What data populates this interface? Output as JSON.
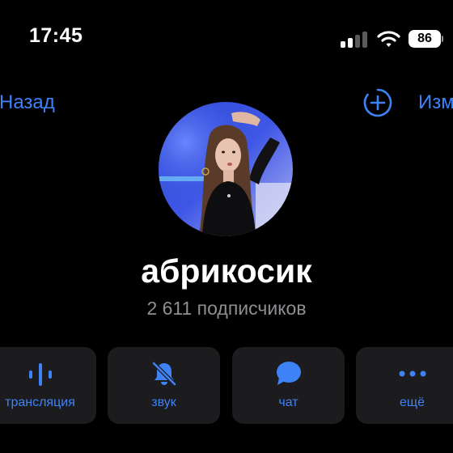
{
  "status_bar": {
    "time": "17:45",
    "battery": "86",
    "icons": [
      "cellular-signal-icon",
      "wifi-icon",
      "battery-icon"
    ]
  },
  "nav": {
    "back_label": "Назад",
    "add_icon": "add-circle-icon",
    "edit_label": "Изм"
  },
  "profile": {
    "name": "абрикосик",
    "subscribers": "2 611 подписчиков"
  },
  "actions": [
    {
      "label": "трансляция",
      "icon": "live-stream-icon"
    },
    {
      "label": "звук",
      "icon": "bell-muted-icon"
    },
    {
      "label": "чат",
      "icon": "chat-bubble-icon"
    },
    {
      "label": "ещё",
      "icon": "more-dots-icon"
    }
  ],
  "colors": {
    "background": "#000000",
    "accent": "#3e82f7",
    "secondary_text": "#8e8e93",
    "button_bg": "#1c1c1e"
  }
}
